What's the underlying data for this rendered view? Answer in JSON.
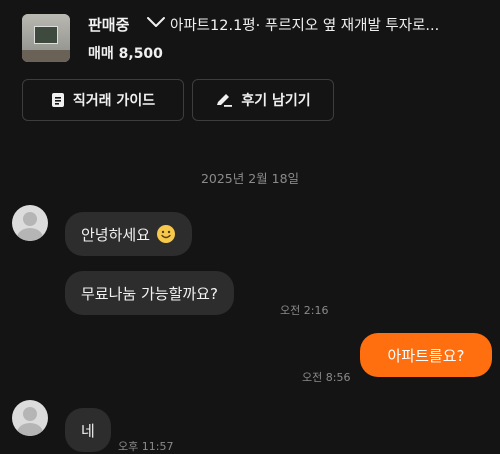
{
  "header": {
    "status": "판매중",
    "title": "아파트12.1평· 푸르지오 옆 재개발 투자로...",
    "price": "매매 8,500",
    "buttons": [
      {
        "label": "직거래 가이드",
        "icon": "document-icon"
      },
      {
        "label": "후기 남기기",
        "icon": "pencil-icon"
      }
    ]
  },
  "chat": {
    "date": "2025년 2월 18일",
    "messages": [
      {
        "side": "received",
        "text": "안녕하세요",
        "emoji": "smile-emoji"
      },
      {
        "side": "received",
        "text": "무료나눔 가능할까요?",
        "time": "오전 2:16"
      },
      {
        "side": "sent",
        "text": "아파트를요?",
        "time": "오전 8:56"
      },
      {
        "side": "received",
        "text": "네",
        "time": "오후 11:57"
      }
    ]
  },
  "colors": {
    "background": "#141414",
    "received_bubble": "#2d2d2d",
    "sent_bubble": "#ff6f0f",
    "meta_text": "#8a8a8a"
  }
}
